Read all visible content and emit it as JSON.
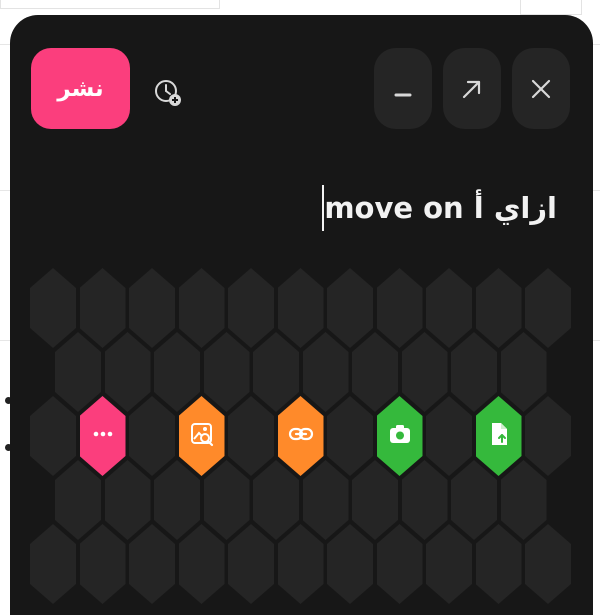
{
  "window": {
    "title": "",
    "minimize_icon": "minimize-icon",
    "expand_icon": "expand-icon",
    "close_icon": "close-icon"
  },
  "toolbar": {
    "publish_label": "نشر",
    "add_icon": "add-circle-icon"
  },
  "composer": {
    "text": "ازاي أ move on"
  },
  "actions": [
    {
      "name": "more-options",
      "icon": "more-horizontal-icon",
      "color": "#fb3e7d"
    },
    {
      "name": "image-search",
      "icon": "image-search-icon",
      "color": "#ff8a2a"
    },
    {
      "name": "link",
      "icon": "link-icon",
      "color": "#ff8a2a"
    },
    {
      "name": "camera",
      "icon": "camera-icon",
      "color": "#35b93c"
    },
    {
      "name": "upload-file",
      "icon": "file-upload-icon",
      "color": "#35b93c"
    }
  ],
  "colors": {
    "modal_background": "#171717",
    "button_background": "#252525",
    "accent_pink": "#fb3e7d",
    "accent_orange": "#ff8a2a",
    "accent_green": "#35b93c",
    "text": "#f2f2f2"
  }
}
